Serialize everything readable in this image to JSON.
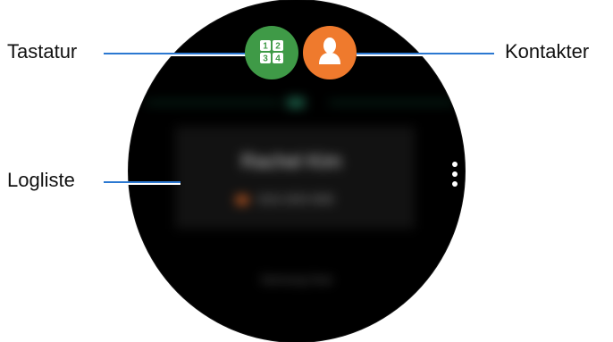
{
  "callouts": {
    "keypad": "Tastatur",
    "contacts": "Kontakter",
    "log": "Logliste"
  },
  "log": {
    "name": "Rachel Kim",
    "number": "010-203-500",
    "footer": "Samsung Gear"
  },
  "icons": {
    "keypad": "keypad-icon",
    "contacts": "contact-icon",
    "more": "more-vertical-icon"
  },
  "colors": {
    "keypad": "#3f9a47",
    "contacts": "#ef7a2d",
    "callout": "#2b78d1"
  }
}
